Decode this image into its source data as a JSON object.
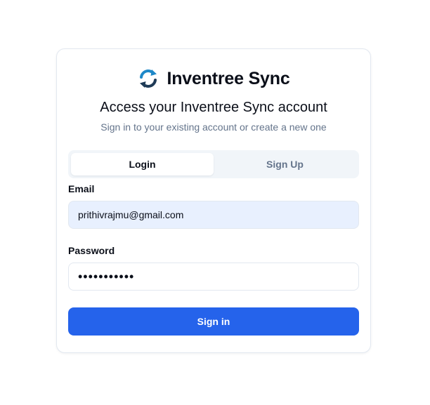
{
  "brand": {
    "name": "Inventree Sync",
    "icon": "sync-arrows-icon"
  },
  "heading": "Access your Inventree Sync account",
  "subheading": "Sign in to your existing account or create a new one",
  "tabs": [
    {
      "label": "Login",
      "active": true
    },
    {
      "label": "Sign Up",
      "active": false
    }
  ],
  "form": {
    "email_label": "Email",
    "email_value": "prithivrajmu@gmail.com",
    "password_label": "Password",
    "password_value": "abcdefghijk",
    "submit_label": "Sign in"
  },
  "colors": {
    "primary": "#2563eb",
    "autofill_bg": "#e8f0fe",
    "muted_text": "#64748b",
    "border": "#e2e8f0",
    "tab_track": "#f1f5f9"
  }
}
